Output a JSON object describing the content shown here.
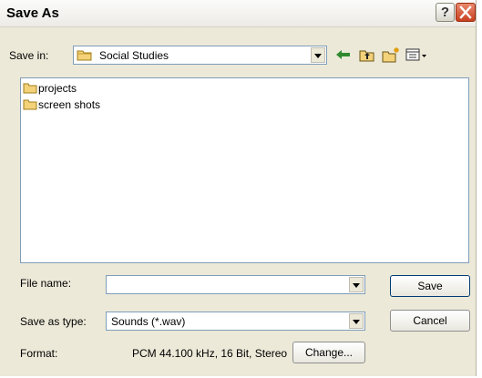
{
  "window": {
    "title": "Save As"
  },
  "title_buttons": {
    "help": "?"
  },
  "save_in": {
    "label": "Save in:",
    "value": "Social Studies"
  },
  "files": [
    {
      "name": "projects",
      "icon": "folder-icon"
    },
    {
      "name": "screen shots",
      "icon": "folder-icon"
    }
  ],
  "file_name": {
    "label": "File name:",
    "value": ""
  },
  "save_type": {
    "label": "Save as type:",
    "value": "Sounds (*.wav)"
  },
  "format": {
    "label": "Format:",
    "value": "PCM 44.100 kHz, 16 Bit, Stereo"
  },
  "buttons": {
    "save": "Save",
    "cancel": "Cancel",
    "change": "Change..."
  },
  "toolbar_icons": [
    "back-arrow-icon",
    "up-folder-icon",
    "new-folder-icon",
    "view-menu-icon"
  ],
  "colors": {
    "dialog_bg": "#ece9d8",
    "close_button": "#c8401f",
    "folder": "#e8c15a"
  }
}
